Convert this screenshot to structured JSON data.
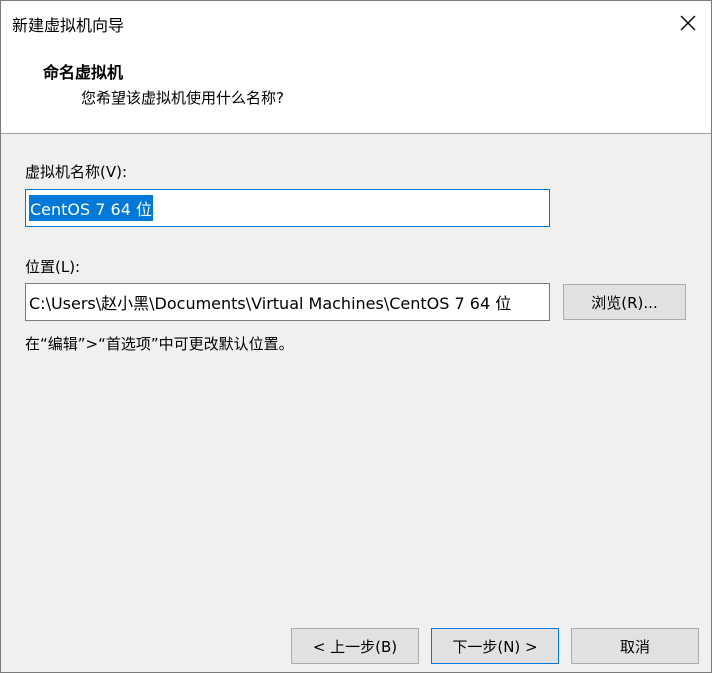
{
  "window": {
    "title": "新建虚拟机向导"
  },
  "header": {
    "heading": "命名虚拟机",
    "subheading": "您希望该虚拟机使用什么名称?"
  },
  "form": {
    "name_label": "虚拟机名称(V):",
    "name_value": "CentOS 7 64 位",
    "location_label": "位置(L):",
    "location_value": "C:\\Users\\赵小黑\\Documents\\Virtual Machines\\CentOS 7 64 位",
    "browse_label": "浏览(R)...",
    "hint": "在“编辑”>“首选项”中可更改默认位置。"
  },
  "buttons": {
    "back": "< 上一步(B)",
    "next": "下一步(N) >",
    "cancel": "取消"
  },
  "colors": {
    "accent": "#0078d7",
    "button_bg": "#e1e1e1",
    "window_bg": "#f0f0f0"
  },
  "icons": {
    "close": "close-icon"
  }
}
